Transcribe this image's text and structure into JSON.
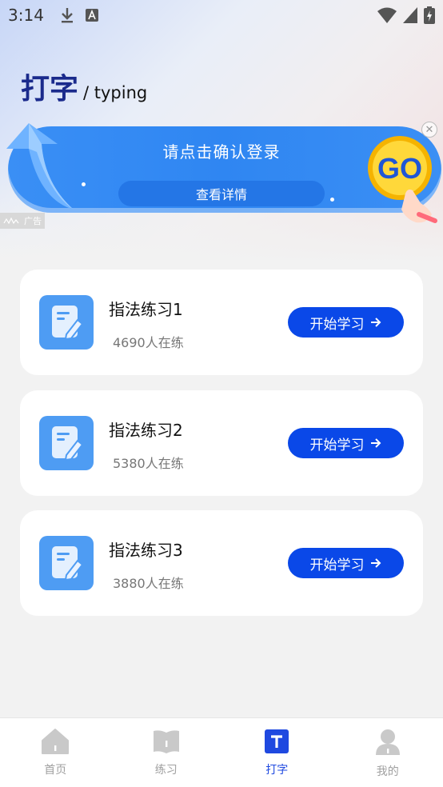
{
  "status_bar": {
    "time": "3:14"
  },
  "header": {
    "title": "打字",
    "subtitle": "/ typing"
  },
  "ad": {
    "text": "请点击确认登录",
    "detail_label": "查看详情",
    "badge": "GO",
    "tag": "广告"
  },
  "cards": [
    {
      "title": "指法练习1",
      "count": "4690人在练",
      "button": "开始学习"
    },
    {
      "title": "指法练习2",
      "count": "5380人在练",
      "button": "开始学习"
    },
    {
      "title": "指法练习3",
      "count": "3880人在练",
      "button": "开始学习"
    }
  ],
  "nav": {
    "items": [
      {
        "label": "首页",
        "icon": "home-icon"
      },
      {
        "label": "练习",
        "icon": "book-icon"
      },
      {
        "label": "打字",
        "icon": "typing-icon"
      },
      {
        "label": "我的",
        "icon": "user-icon"
      }
    ],
    "active_index": 2
  },
  "colors": {
    "accent": "#0a48e8",
    "banner": "#3a8ff5",
    "icon_bg": "#4e9cf3"
  }
}
